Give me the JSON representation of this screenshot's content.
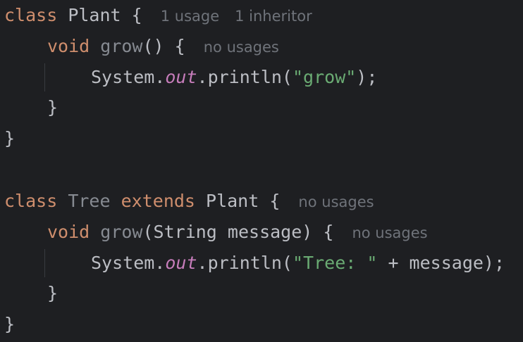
{
  "code": {
    "plant_class": {
      "keyword": "class",
      "name": "Plant",
      "open_brace": "{",
      "hint_usage": "1 usage",
      "hint_inheritor": "1 inheritor"
    },
    "plant_method": {
      "keyword": "void",
      "name": "grow",
      "params": "()",
      "open_brace": "{",
      "hint": "no usages"
    },
    "plant_statement": {
      "receiver": "System.",
      "field": "out",
      "call": ".println(",
      "string": "\"grow\"",
      "end": ");"
    },
    "plant_method_close": "}",
    "plant_class_close": "}",
    "tree_class": {
      "keyword": "class",
      "name": "Tree",
      "extends_keyword": "extends",
      "super_name": "Plant",
      "open_brace": "{",
      "hint": "no usages"
    },
    "tree_method": {
      "keyword": "void",
      "name": "grow",
      "params": "(String message)",
      "open_brace": "{",
      "hint": "no usages"
    },
    "tree_statement": {
      "receiver": "System.",
      "field": "out",
      "call": ".println(",
      "string": "\"Tree: \"",
      "rest": " + message);"
    },
    "tree_method_close": "}",
    "tree_class_close": "}"
  },
  "colors": {
    "background": "#1e1f22",
    "keyword": "#cf8e6d",
    "plain_text": "#bcbec4",
    "unused_symbol": "#868a91",
    "static_field": "#c77dbb",
    "string_literal": "#6aab73",
    "inlay_hint": "#6f737a"
  }
}
